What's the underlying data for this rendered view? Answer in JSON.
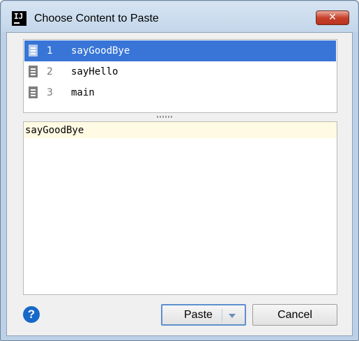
{
  "window": {
    "title": "Choose Content to Paste",
    "app_icon_text": "IJ",
    "close_symbol": "✕"
  },
  "list": {
    "items": [
      {
        "number": "1",
        "label": "sayGoodBye",
        "icon": "document-icon",
        "selected": true
      },
      {
        "number": "2",
        "label": "sayHello",
        "icon": "document-icon",
        "selected": false
      },
      {
        "number": "3",
        "label": "main",
        "icon": "document-icon",
        "selected": false
      }
    ]
  },
  "preview": {
    "text": "sayGoodBye"
  },
  "footer": {
    "help_symbol": "?",
    "paste_label": "Paste",
    "cancel_label": "Cancel"
  },
  "colors": {
    "selection": "#3875d7",
    "preview_highlight": "#fffae3",
    "help_button": "#1769c9",
    "close_button": "#c7412b"
  }
}
